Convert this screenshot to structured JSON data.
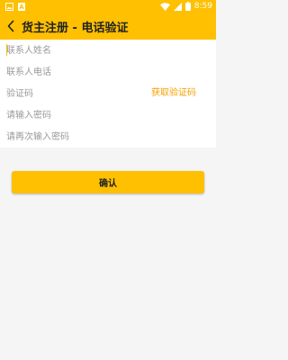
{
  "status_bar": {
    "time": "8:59",
    "left_icons": [
      "image-icon",
      "notification-icon"
    ],
    "right_icons": [
      "wifi-icon",
      "signal-icon",
      "battery-icon"
    ]
  },
  "header": {
    "title": "货主注册 - 电话验证"
  },
  "form": {
    "contact_name": {
      "placeholder": "联系人姓名",
      "value": ""
    },
    "contact_phone": {
      "placeholder": "联系人电话",
      "value": ""
    },
    "verification_code": {
      "placeholder": "验证码",
      "value": ""
    },
    "get_code_label": "获取验证码",
    "password": {
      "placeholder": "请输入密码",
      "value": ""
    },
    "password_confirm": {
      "placeholder": "请再次输入密码",
      "value": ""
    }
  },
  "confirm_label": "确认",
  "colors": {
    "accent": "#fec000",
    "link": "#f5a000",
    "background": "#f5f5f5"
  }
}
